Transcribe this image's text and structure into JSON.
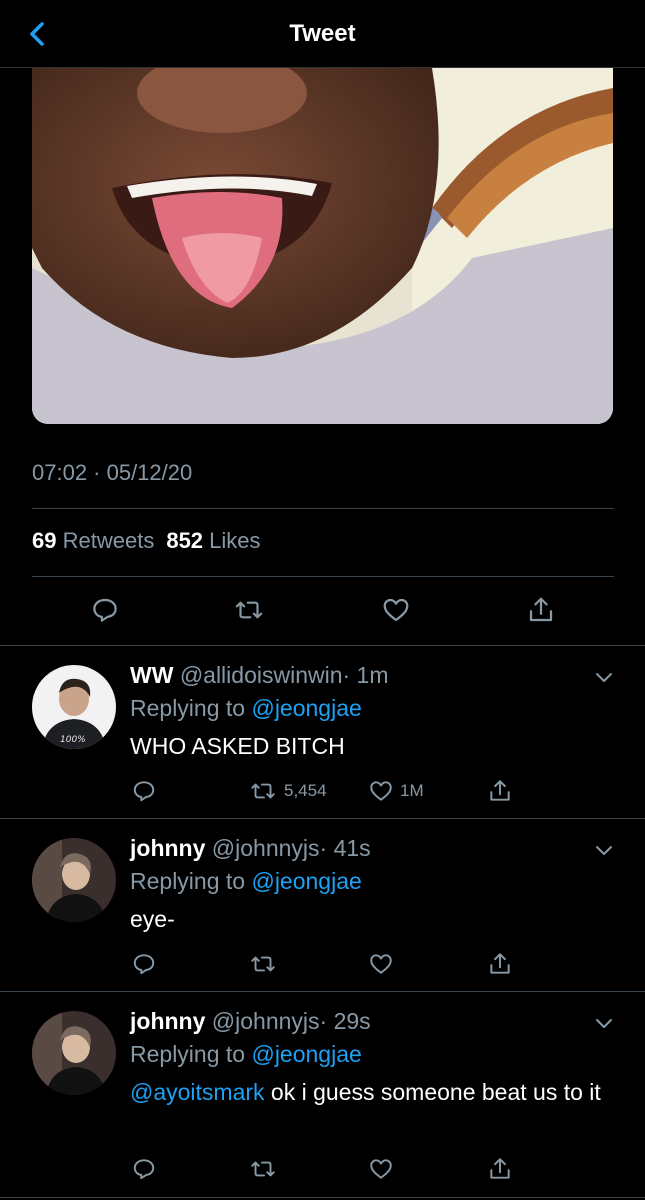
{
  "header": {
    "title": "Tweet",
    "back_icon": "chevron-left-icon",
    "accent": "#1da1f2"
  },
  "tweet": {
    "timestamp": "07:02 · 05/12/20",
    "retweets_count": "69",
    "retweets_label": "Retweets",
    "likes_count": "852",
    "likes_label": "Likes",
    "actions": [
      "reply-icon",
      "retweet-icon",
      "like-icon",
      "share-icon"
    ]
  },
  "replies": [
    {
      "name": "WW",
      "handle": "@allidoiswinwin",
      "time": "· 1m",
      "replying_prefix": "Replying to",
      "replying_to": "@jeongjae",
      "text_mention": "",
      "text": "WHO ASKED BITCH",
      "retweets": "5,454",
      "likes": "1M"
    },
    {
      "name": "johnny",
      "handle": "@johnnyjs",
      "time": "· 41s",
      "replying_prefix": "Replying to",
      "replying_to": "@jeongjae",
      "text_mention": "",
      "text": "eye-",
      "retweets": "",
      "likes": ""
    },
    {
      "name": "johnny",
      "handle": "@johnnyjs",
      "time": "· 29s",
      "replying_prefix": "Replying to",
      "replying_to": "@jeongjae",
      "text_mention": "@ayoitsmark",
      "text": " ok i guess someone beat us to it",
      "retweets": "",
      "likes": ""
    }
  ]
}
